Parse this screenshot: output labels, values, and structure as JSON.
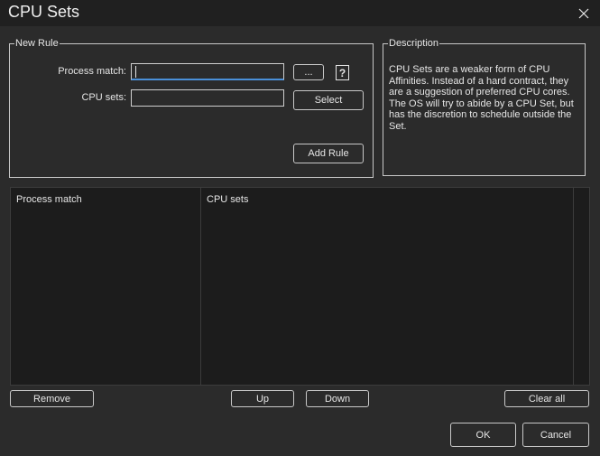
{
  "window": {
    "title": "CPU Sets"
  },
  "new_rule": {
    "group_title": "New Rule",
    "process_match_label": "Process match:",
    "process_match_value": "",
    "cpu_sets_label": "CPU sets:",
    "cpu_sets_value": "",
    "browse_button": "...",
    "help_icon": "?",
    "select_button": "Select",
    "add_rule_button": "Add Rule"
  },
  "description": {
    "group_title": "Description",
    "text": "CPU Sets are a weaker form of CPU Affinities. Instead of a hard contract, they are a suggestion of preferred CPU cores. The OS will try to abide by a CPU Set, but has the discretion to schedule outside the Set."
  },
  "rules_list": {
    "columns": [
      "Process match",
      "CPU sets"
    ],
    "rows": []
  },
  "list_buttons": {
    "remove": "Remove",
    "up": "Up",
    "down": "Down",
    "clear_all": "Clear all"
  },
  "dialog_buttons": {
    "ok": "OK",
    "cancel": "Cancel"
  },
  "icons": {
    "close": "close-icon",
    "help": "help-icon"
  },
  "colors": {
    "background": "#2b2b2b",
    "titlebar": "#202020",
    "list_bg": "#1c1c1c",
    "focus_accent": "#4a8fd8"
  }
}
